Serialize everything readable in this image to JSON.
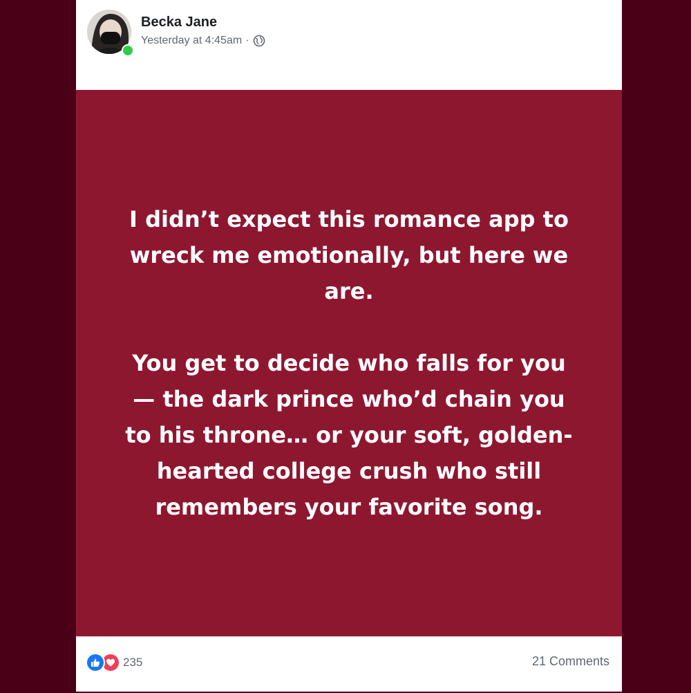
{
  "post": {
    "author": "Becka Jane",
    "timestamp": "Yesterday at 4:45am",
    "separator": "·",
    "privacy_icon": "globe-icon",
    "avatar_online": true,
    "background_color": "#8e1730",
    "paragraphs": [
      "I didn’t expect this romance app to wreck me emotionally, but here we are.",
      "You get to decide who falls for you — the dark prince who’d chain you to his throne… or your soft, golden-hearted college crush who still remembers your favorite song."
    ]
  },
  "footer": {
    "reaction_icons": [
      "like-icon",
      "love-icon"
    ],
    "reaction_count": "235",
    "comments_label": "21 Comments"
  }
}
